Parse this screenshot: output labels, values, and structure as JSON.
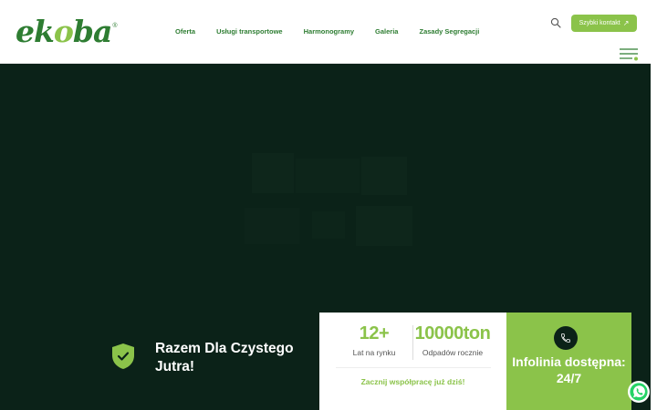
{
  "logo": {
    "prefix": "ek",
    "o": "o",
    "suffix": "ba",
    "reg": "®"
  },
  "nav": {
    "items": [
      {
        "label": "Oferta"
      },
      {
        "label": "Usługi transportowe"
      },
      {
        "label": "Harmonogramy"
      },
      {
        "label": "Galeria"
      },
      {
        "label": "Zasady Segregacji"
      }
    ]
  },
  "header": {
    "quick_contact_label": "Szybki kontakt",
    "quick_contact_arrow": "↗"
  },
  "hero": {
    "tagline": "Razem Dla Czystego Jutra!"
  },
  "stats": [
    {
      "value": "12+",
      "label": "Lat na rynku"
    },
    {
      "value": "10000ton",
      "label": "Odpadów rocznie"
    }
  ],
  "cta": {
    "label": "Zacznij współpracę już dziś!"
  },
  "hotline": {
    "text": "Infolinia dostępna: 24/7"
  },
  "colors": {
    "brand_green": "#2e7d32",
    "accent_lime": "#8bc34a",
    "hero_bg": "#0b2218",
    "whatsapp": "#25d366"
  }
}
